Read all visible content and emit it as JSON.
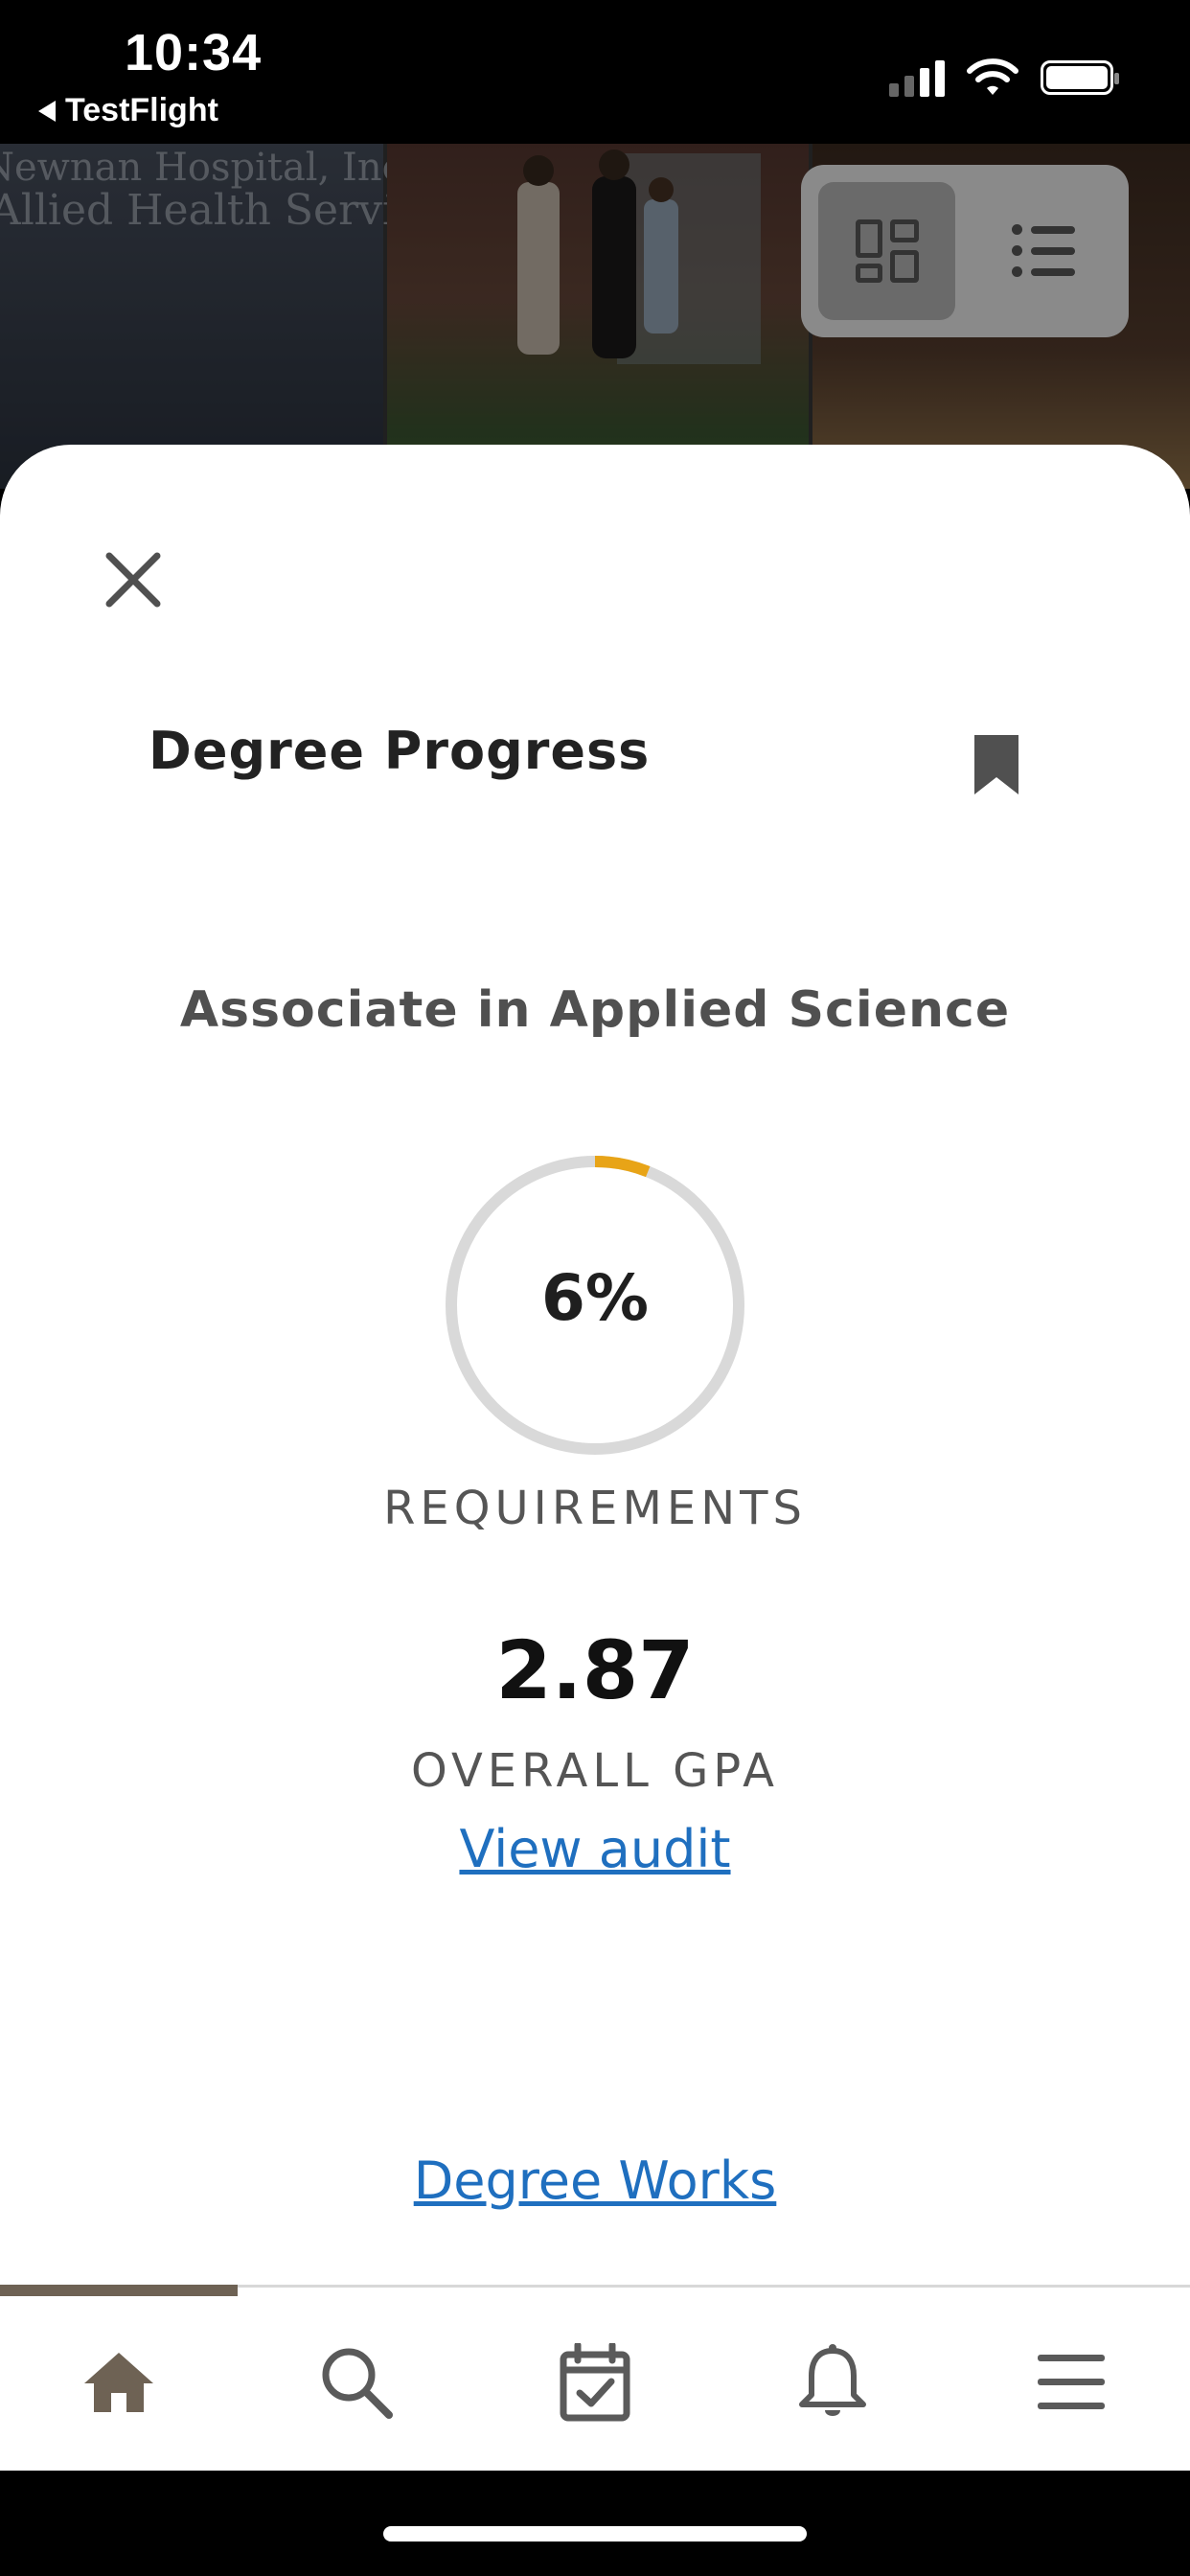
{
  "status_bar": {
    "time": "10:34",
    "back_label": "TestFlight"
  },
  "hero": {
    "sign_line1": "Newnan Hospital, Inc.",
    "sign_line2": "Allied Health Services Building",
    "view_modes": [
      "grid",
      "list"
    ],
    "active_view": "grid"
  },
  "sheet": {
    "title": "Degree Progress",
    "degree_name": "Associate in Applied Science",
    "progress_percent": 6,
    "progress_text": "6%",
    "progress_label": "REQUIREMENTS",
    "gpa_value": "2.87",
    "gpa_label": "OVERALL GPA",
    "view_audit_link": "View audit",
    "degree_works_link": "Degree Works",
    "colors": {
      "progress_fill": "#e8a417",
      "progress_track": "#d9d9d9",
      "link": "#1f6fbf"
    }
  },
  "tab_bar": {
    "items": [
      "home",
      "search",
      "calendar",
      "notifications",
      "menu"
    ],
    "active": "home",
    "indicator_color": "#6e6254"
  }
}
